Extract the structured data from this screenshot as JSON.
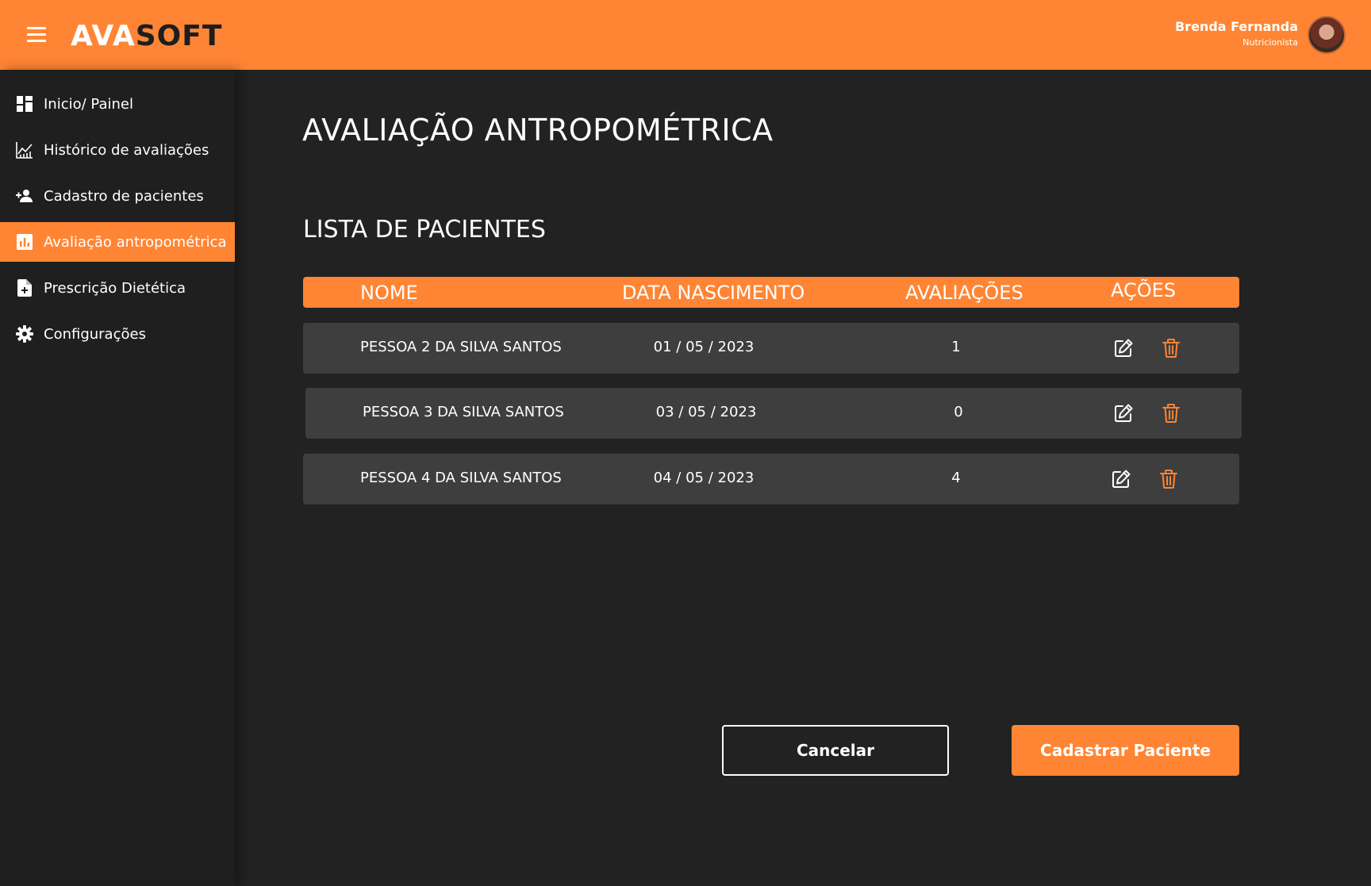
{
  "header": {
    "brand_part1": "AVA",
    "brand_part2": "SOFT",
    "user_name": "Brenda Fernanda",
    "user_role": "Nutricionista"
  },
  "sidebar": {
    "items": [
      {
        "label": "Inicio/ Painel",
        "icon": "dashboard-icon"
      },
      {
        "label": "Histórico de avaliações",
        "icon": "chart-line-icon"
      },
      {
        "label": "Cadastro de pacientes",
        "icon": "person-add-icon"
      },
      {
        "label": "Avaliação antropométrica",
        "icon": "bar-chart-icon",
        "active": true
      },
      {
        "label": "Prescrição Dietética",
        "icon": "file-add-icon"
      },
      {
        "label": "Configurações",
        "icon": "gear-icon"
      }
    ]
  },
  "main": {
    "title": "AVALIAÇÃO ANTROPOMÉTRICA",
    "section_title": "LISTA DE PACIENTES"
  },
  "table": {
    "headers": [
      "NOME",
      "DATA NASCIMENTO",
      "AVALIAÇÕES",
      "AÇÕES"
    ],
    "rows": [
      {
        "name": "PESSOA 2 DA SILVA SANTOS",
        "birth": "01 / 05 / 2023",
        "evaluations": "1"
      },
      {
        "name": "PESSOA 3 DA SILVA SANTOS",
        "birth": "03 / 05 / 2023",
        "evaluations": "0"
      },
      {
        "name": "PESSOA 4 DA SILVA SANTOS",
        "birth": "04 / 05 / 2023",
        "evaluations": "4"
      }
    ]
  },
  "actions": {
    "cancel_label": "Cancelar",
    "submit_label": "Cadastrar Paciente"
  },
  "colors": {
    "accent": "#ff8534",
    "background": "#222222",
    "sidebar": "#1f1f1f",
    "row": "#3e3e3e"
  }
}
